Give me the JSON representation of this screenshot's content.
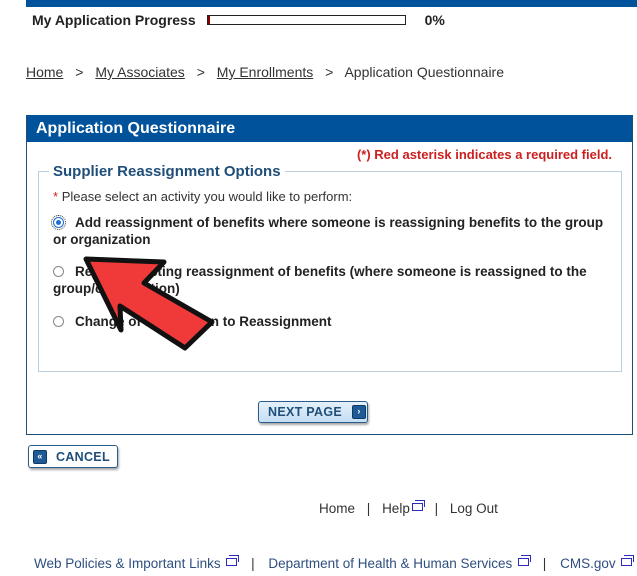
{
  "progress": {
    "label": "My Application Progress",
    "percent_value": 0,
    "percent_text": "0%"
  },
  "breadcrumb": {
    "items": [
      "Home",
      "My Associates",
      "My Enrollments"
    ],
    "separator": ">",
    "current": "Application Questionnaire"
  },
  "panel": {
    "title": "Application Questionnaire",
    "required_note": "(*) Red asterisk indicates a required field.",
    "fieldset_legend": "Supplier Reassignment Options",
    "prompt_star": "*",
    "prompt": "Please select an activity you would like to perform:",
    "options": [
      {
        "label": "Add reassignment of benefits where someone is reassigning benefits to the group or organization",
        "selected": true
      },
      {
        "label": "Remove existing reassignment of benefits (where someone is reassigned to the group/organization)",
        "selected": false
      },
      {
        "label": "Change of Information to Reassignment",
        "selected": false
      }
    ],
    "next_button": "NEXT PAGE",
    "next_icon": "›"
  },
  "cancel": {
    "label": "CANCEL",
    "icon": "«"
  },
  "footer": {
    "links": [
      "Home",
      "Help",
      "Log Out"
    ],
    "separator": "|"
  },
  "bottom_links": {
    "items": [
      "Web Policies & Important Links",
      "Department of Health & Human Services",
      "CMS.gov"
    ],
    "separator": "|"
  },
  "colors": {
    "brand_blue": "#00529b",
    "required_red": "#cc1f1f",
    "annotation_arrow": "#f03a3a"
  }
}
